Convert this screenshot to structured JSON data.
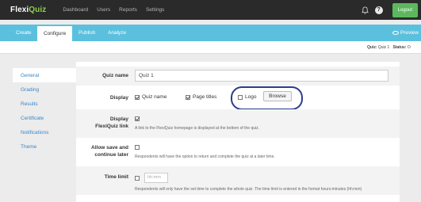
{
  "topnav": {
    "logo_prefix": "Flexi",
    "logo_suffix": "Quiz",
    "links": [
      "Dashboard",
      "Users",
      "Reports",
      "Settings"
    ],
    "logout_label": "Logout"
  },
  "subnav": {
    "tabs": [
      "Create",
      "Configure",
      "Publish",
      "Analyze"
    ],
    "active_tab": "Configure",
    "preview_label": "Preview"
  },
  "infobar": {
    "quiz_label": "Quiz:",
    "quiz_value": "Quiz 1",
    "status_label": "Status:",
    "status_value": "O"
  },
  "sidebar": {
    "items": [
      "General",
      "Grading",
      "Results",
      "Certificate",
      "Notifications",
      "Theme"
    ],
    "active": "General"
  },
  "form": {
    "quiz_name_label": "Quiz name",
    "quiz_name_value": "Quiz 1",
    "display_label": "Display",
    "display_opt_quiz_name": "Quiz name",
    "display_opt_page_titles": "Page titles",
    "display_opt_logo": "Logo",
    "browse_label": "Browse",
    "display_link_label_1": "Display",
    "display_link_label_2": "FlexiQuiz link",
    "display_link_help": "A link to the FlexiQuiz homepage is displayed at the bottom of the quiz.",
    "save_label_1": "Allow save and",
    "save_label_2": "continue later",
    "save_help": "Respondents will have the option to return and complete the quiz at a later time.",
    "time_limit_label": "Time limit",
    "time_limit_placeholder": "hh:mm",
    "time_limit_help": "Respondents will only have the set time to complete the whole quiz. The time limit is entered in the format hours:minutes (hh:mm)"
  }
}
